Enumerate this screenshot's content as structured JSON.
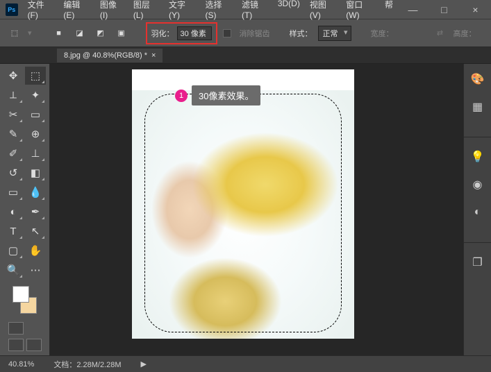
{
  "app_logo": "Ps",
  "menubar": [
    "文件(F)",
    "编辑(E)",
    "图像(I)",
    "图层(L)",
    "文字(Y)",
    "选择(S)",
    "滤镜(T)",
    "3D(D)",
    "视图(V)",
    "窗口(W)",
    "帮"
  ],
  "window_controls": {
    "min": "—",
    "max": "□",
    "close": "×"
  },
  "options_bar": {
    "feather_label": "羽化：",
    "feather_value": "30 像素",
    "antialias": "消除锯齿",
    "style_label": "样式：",
    "style_value": "正常",
    "width_label": "宽度：",
    "height_label": "高度："
  },
  "doc_tab": {
    "title": "8.jpg @ 40.8%(RGB/8) *",
    "close": "×"
  },
  "annotation": {
    "number": "1",
    "text": "30像素效果。"
  },
  "statusbar": {
    "zoom": "40.81%",
    "doc_label": "文档：",
    "doc_size": "2.28M/2.28M",
    "arrow": "▶"
  }
}
